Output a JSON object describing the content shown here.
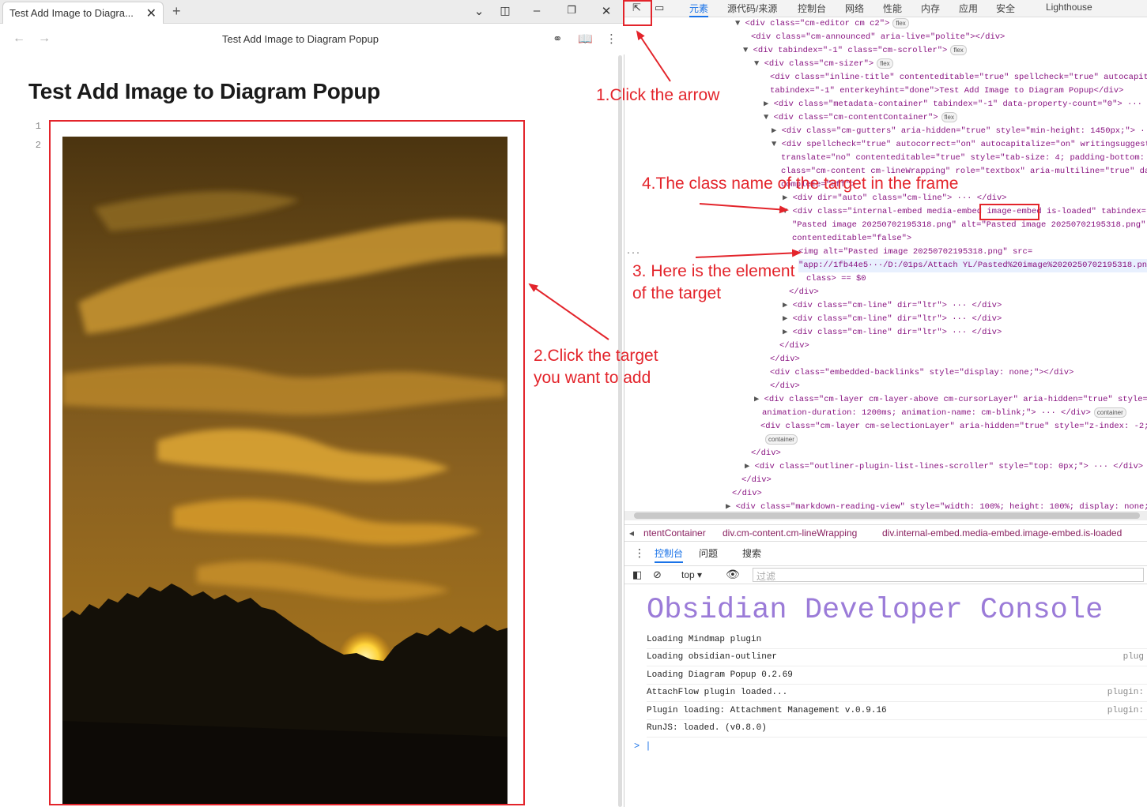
{
  "app": {
    "tab_title": "Test Add Image to Diagra...",
    "nav_title": "Test Add Image to Diagram Popup",
    "note_heading": "Test Add Image to Diagram Popup",
    "line_numbers": [
      "1",
      "2"
    ],
    "window_controls": [
      "chevron-down-icon",
      "sidebar-toggle-icon",
      "minimize-icon",
      "restore-icon",
      "close-icon"
    ]
  },
  "devtools": {
    "tabs": [
      "元素",
      "源代码/来源",
      "控制台",
      "网络",
      "性能",
      "内存",
      "应用",
      "安全",
      "Lighthouse"
    ],
    "elements_lines": [
      {
        "pre": "▼ ",
        "html": "<div class=\"cm-editor cm c2\">",
        "badge": "flex"
      },
      {
        "pre": "",
        "html": "<div class=\"cm-announced\" aria-live=\"polite\"></div>"
      },
      {
        "pre": "▼ ",
        "html": "<div tabindex=\"-1\" class=\"cm-scroller\">",
        "badge": "flex"
      },
      {
        "pre": "▼ ",
        "html": "<div class=\"cm-sizer\">",
        "badge": "flex"
      },
      {
        "pre": "",
        "html": "<div class=\"inline-title\" contenteditable=\"true\" spellcheck=\"true\" autocapital"
      },
      {
        "pre": "",
        "html": "tabindex=\"-1\" enterkeyhint=\"done\">Test Add Image to Diagram Popup</div>"
      },
      {
        "pre": "▶ ",
        "html": "<div class=\"metadata-container\" tabindex=\"-1\" data-property-count=\"0\"> ··· </di"
      },
      {
        "pre": "▼ ",
        "html": "<div class=\"cm-contentContainer\">",
        "badge": "flex"
      },
      {
        "pre": "▶ ",
        "html": "<div class=\"cm-gutters\" aria-hidden=\"true\" style=\"min-height: 1450px;\"> ··· </"
      },
      {
        "pre": "▼ ",
        "html": "<div spellcheck=\"true\" autocorrect=\"on\" autocapitalize=\"on\" writingsuggestio"
      },
      {
        "pre": "",
        "html": "translate=\"no\" contenteditable=\"true\" style=\"tab-size: 4; padding-bottom: 50"
      },
      {
        "pre": "",
        "html": "class=\"cm-content cm-lineWrapping\" role=\"textbox\" aria-multiline=\"true\" data"
      },
      {
        "pre": "",
        "html": "complete=\"off\">"
      },
      {
        "pre": "▶ ",
        "html": "<div dir=\"auto\" class=\"cm-line\"> ··· </div>"
      },
      {
        "pre": "▼ ",
        "html": "<div class=\"internal-embed media-embed image-embed is-loaded\" tabindex=\"-1"
      },
      {
        "pre": "",
        "html": "\"Pasted image 20250702195318.png\" alt=\"Pasted image 20250702195318.png\""
      },
      {
        "pre": "",
        "html": "contenteditable=\"false\">"
      },
      {
        "pre": "",
        "html": "<img alt=\"Pasted image 20250702195318.png\" src="
      },
      {
        "pre": "",
        "html": "\"app://1fb44e5···/D:/01ps/Attach YL/Pasted%20image%2020250702195318.png?1"
      },
      {
        "pre": "",
        "html": "class> == $0"
      },
      {
        "pre": "",
        "html": "</div>"
      },
      {
        "pre": "▶ ",
        "html": "<div class=\"cm-line\" dir=\"ltr\"> ··· </div>"
      },
      {
        "pre": "▶ ",
        "html": "<div class=\"cm-line\" dir=\"ltr\"> ··· </div>"
      },
      {
        "pre": "▶ ",
        "html": "<div class=\"cm-line\" dir=\"ltr\"> ··· </div>"
      },
      {
        "pre": "",
        "html": "</div>"
      },
      {
        "pre": "",
        "html": "</div>"
      },
      {
        "pre": "",
        "html": "<div class=\"embedded-backlinks\" style=\"display: none;\"></div>"
      },
      {
        "pre": "",
        "html": "</div>"
      },
      {
        "pre": "▶ ",
        "html": "<div class=\"cm-layer cm-layer-above cm-cursorLayer\" aria-hidden=\"true\" style=\"z-"
      },
      {
        "pre": "",
        "html": "animation-duration: 1200ms; animation-name: cm-blink;\"> ··· </div>",
        "badge": "container"
      },
      {
        "pre": "",
        "html": "<div class=\"cm-layer cm-selectionLayer\" aria-hidden=\"true\" style=\"z-index: -2;\">"
      },
      {
        "pre": "",
        "html": "",
        "badge": "container"
      },
      {
        "pre": "",
        "html": "</div>"
      },
      {
        "pre": "▶ ",
        "html": "<div class=\"outliner-plugin-list-lines-scroller\" style=\"top: 0px;\"> ··· </div>"
      },
      {
        "pre": "",
        "html": "</div>"
      },
      {
        "pre": "",
        "html": "</div>"
      },
      {
        "pre": "▶ ",
        "html": "<div class=\"markdown-reading-view\" style=\"width: 100%; height: 100%; display: none;\">"
      }
    ],
    "breadcrumbs": [
      "ntentContainer",
      "div.cm-content.cm-lineWrapping",
      "div.internal-embed.media-embed.image-embed.is-loaded"
    ],
    "console_tabs": [
      "控制台",
      "问题",
      "搜索"
    ],
    "console_context": "top",
    "filter_placeholder": "过滤",
    "console_banner": "Obsidian Developer Console",
    "console_logs": [
      {
        "text": "Loading Mindmap plugin",
        "src": ""
      },
      {
        "text": "Loading obsidian-outliner",
        "src": "plug"
      },
      {
        "text": "Loading Diagram Popup 0.2.69",
        "src": ""
      },
      {
        "text": "AttachFlow plugin loaded...",
        "src": "plugin:"
      },
      {
        "text": "Plugin loading: Attachment Management v.0.9.16",
        "src": "plugin:"
      },
      {
        "text": "RunJS: loaded. (v0.8.0)",
        "src": ""
      }
    ],
    "prompt": "> |"
  },
  "annotations": {
    "step1": "1.Click the arrow",
    "step2_line1": "2.Click the target",
    "step2_line2": "you want to add",
    "step3_line1": "3. Here is the element",
    "step3_line2": "of the target",
    "step4": "4.The class name of the target in the frame"
  },
  "colors": {
    "annotation_red": "#e3242b",
    "devtools_accent": "#1a73e8",
    "console_banner": "#9b7bd8"
  }
}
